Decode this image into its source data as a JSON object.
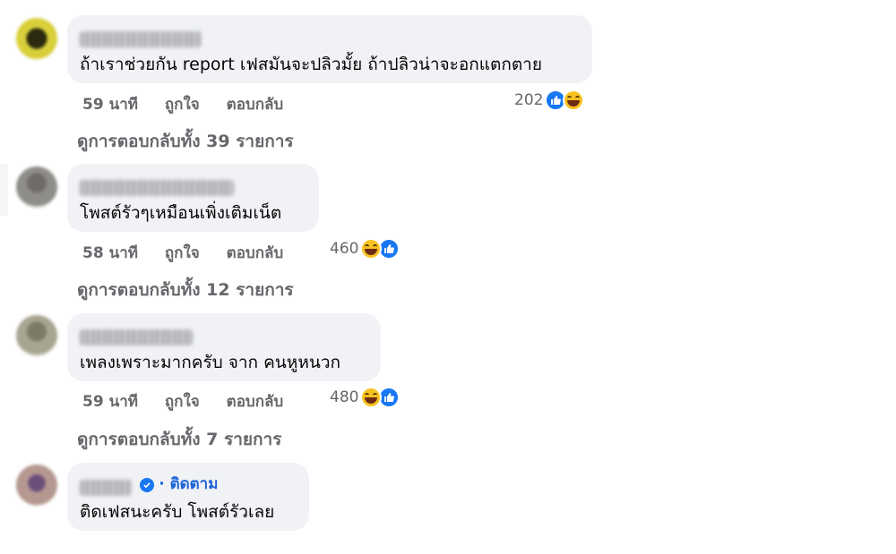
{
  "comments": [
    {
      "author": "",
      "text": "ถ้าเราช่วยกัน report เฟสมันจะปลิวมั้ย ถ้าปลิวน่าจะอกแตกตาย",
      "time": "59 นาที",
      "like": "ถูกใจ",
      "reply": "ตอบกลับ",
      "reaction_count": "202",
      "reaction_order": [
        "like-icon",
        "haha-icon"
      ],
      "view_replies": "ดูการตอบกลับทั้ง 39 รายการ",
      "avatar_colors": [
        "#d8cf3a",
        "#2b2a10"
      ]
    },
    {
      "author": "",
      "text": "โพสต์รัวๆเหมือนเพิ่งเติมเน็ต",
      "time": "58 นาที",
      "like": "ถูกใจ",
      "reply": "ตอบกลับ",
      "reaction_count": "460",
      "reaction_order": [
        "haha-icon",
        "like-icon"
      ],
      "view_replies": "ดูการตอบกลับทั้ง 12 รายการ",
      "avatar_colors": [
        "#8f8d88",
        "#6f6b69"
      ]
    },
    {
      "author": "",
      "text": "เพลงเพราะมากครับ จาก คนหูหนวก",
      "time": "59 นาที",
      "like": "ถูกใจ",
      "reply": "ตอบกลับ",
      "reaction_count": "480",
      "reaction_order": [
        "haha-icon",
        "like-icon"
      ],
      "view_replies": "ดูการตอบกลับทั้ง 7 รายการ",
      "avatar_colors": [
        "#a8a592",
        "#7d7a68"
      ]
    },
    {
      "author": "",
      "text": "ติดเฟสนะครับ โพสต์รัวเลย",
      "follow": "· ติดตาม",
      "avatar_colors": [
        "#b59890",
        "#6b4d7a"
      ]
    }
  ],
  "colors": {
    "bubble": "#f0f2f5",
    "meta_text": "#65676b",
    "like_blue": "#1877f2",
    "haha_yellow": "#f7c21f",
    "follow_blue": "#1d63d8"
  }
}
